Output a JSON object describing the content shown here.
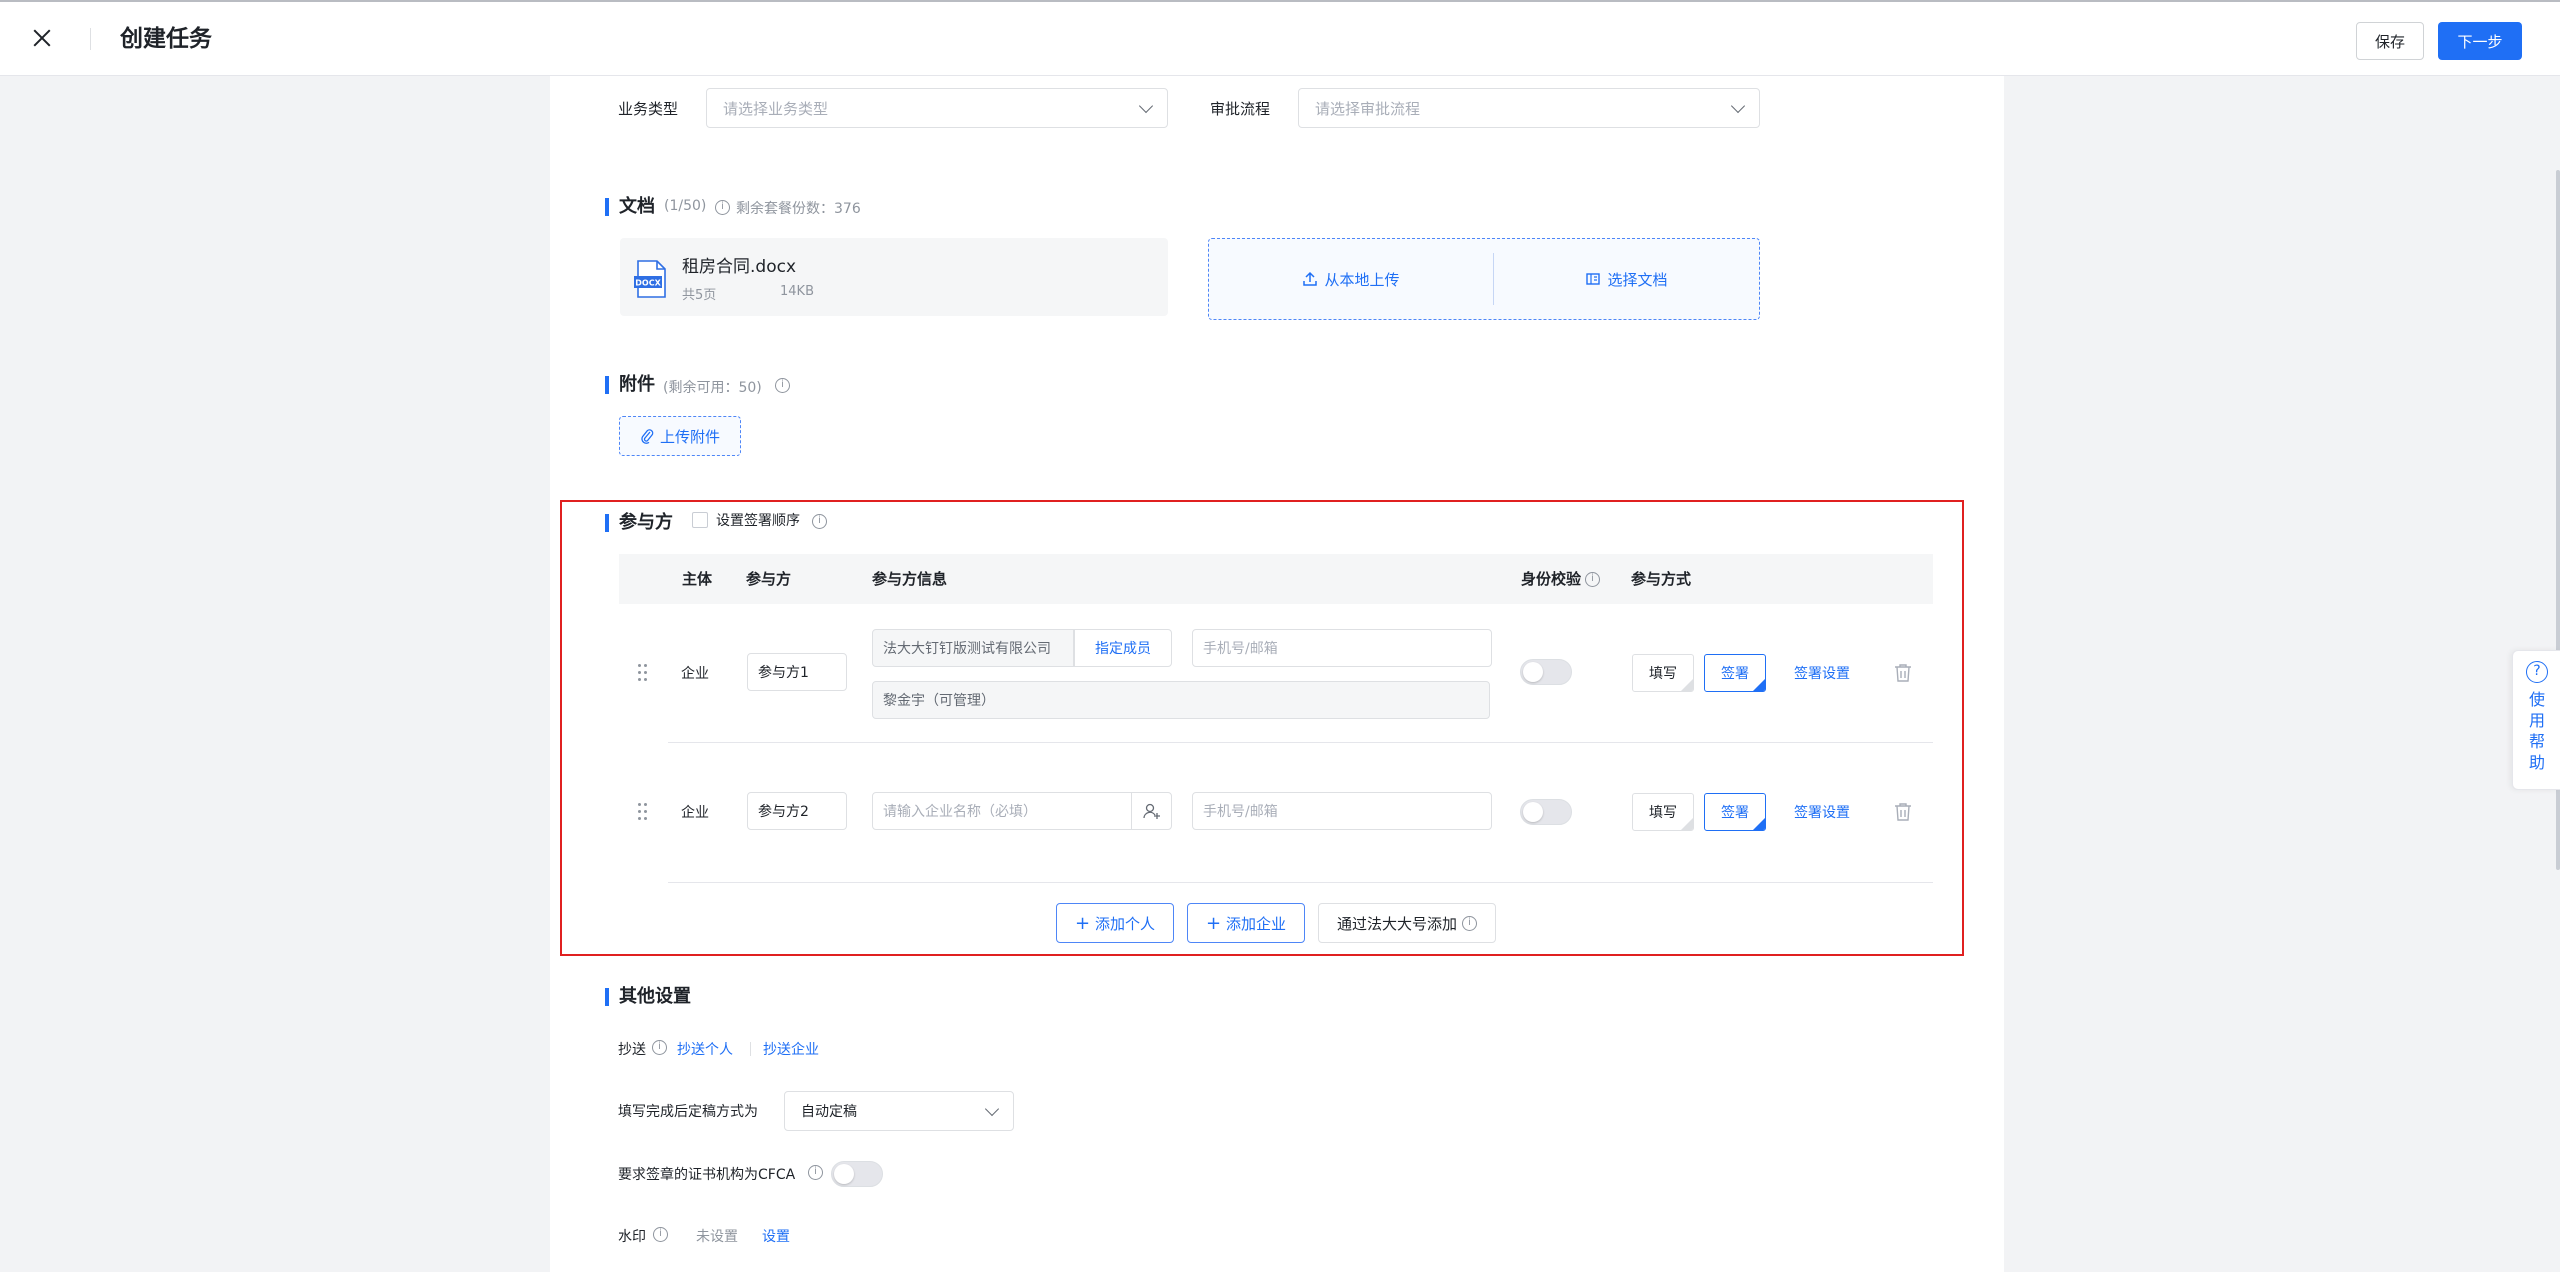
{
  "header": {
    "title": "创建任务",
    "save_label": "保存",
    "next_label": "下一步"
  },
  "business": {
    "type_label": "业务类型",
    "type_placeholder": "请选择业务类型",
    "flow_label": "审批流程",
    "flow_placeholder": "请选择审批流程"
  },
  "documents": {
    "title": "文档",
    "count": "(1/50)",
    "remaining": "剩余套餐份数：376",
    "file": {
      "icon_text": "DOCX",
      "name": "租房合同.docx",
      "pages": "共5页",
      "size": "14KB"
    },
    "upload_local": "从本地上传",
    "choose_doc": "选择文档"
  },
  "attachments": {
    "title": "附件",
    "remaining": "(剩余可用：50)",
    "upload_label": "上传附件"
  },
  "participants": {
    "title": "参与方",
    "order_checkbox_label": "设置签署顺序",
    "columns": {
      "subject": "主体",
      "party": "参与方",
      "info": "参与方信息",
      "verify": "身份校验",
      "method": "参与方式"
    },
    "rows": [
      {
        "subject": "企业",
        "party": "参与方1",
        "company": "法大大钉钉版测试有限公司",
        "assign_member": "指定成员",
        "contact_placeholder": "手机号/邮箱",
        "member": "黎金宇（可管理）",
        "fill": "填写",
        "sign": "签署",
        "settings": "签署设置"
      },
      {
        "subject": "企业",
        "party": "参与方2",
        "company_placeholder": "请输入企业名称（必填）",
        "contact_placeholder": "手机号/邮箱",
        "fill": "填写",
        "sign": "签署",
        "settings": "签署设置"
      }
    ],
    "add_person": "添加个人",
    "add_company": "添加企业",
    "add_via_account": "通过法大大号添加"
  },
  "other": {
    "title": "其他设置",
    "cc_label": "抄送",
    "cc_person": "抄送个人",
    "cc_company": "抄送企业",
    "finalize_label": "填写完成后定稿方式为",
    "finalize_value": "自动定稿",
    "cfca_label": "要求签章的证书机构为CFCA",
    "watermark_label": "水印",
    "watermark_status": "未设置",
    "watermark_action": "设置"
  },
  "help": {
    "icon": "?",
    "text": "使用帮助"
  }
}
